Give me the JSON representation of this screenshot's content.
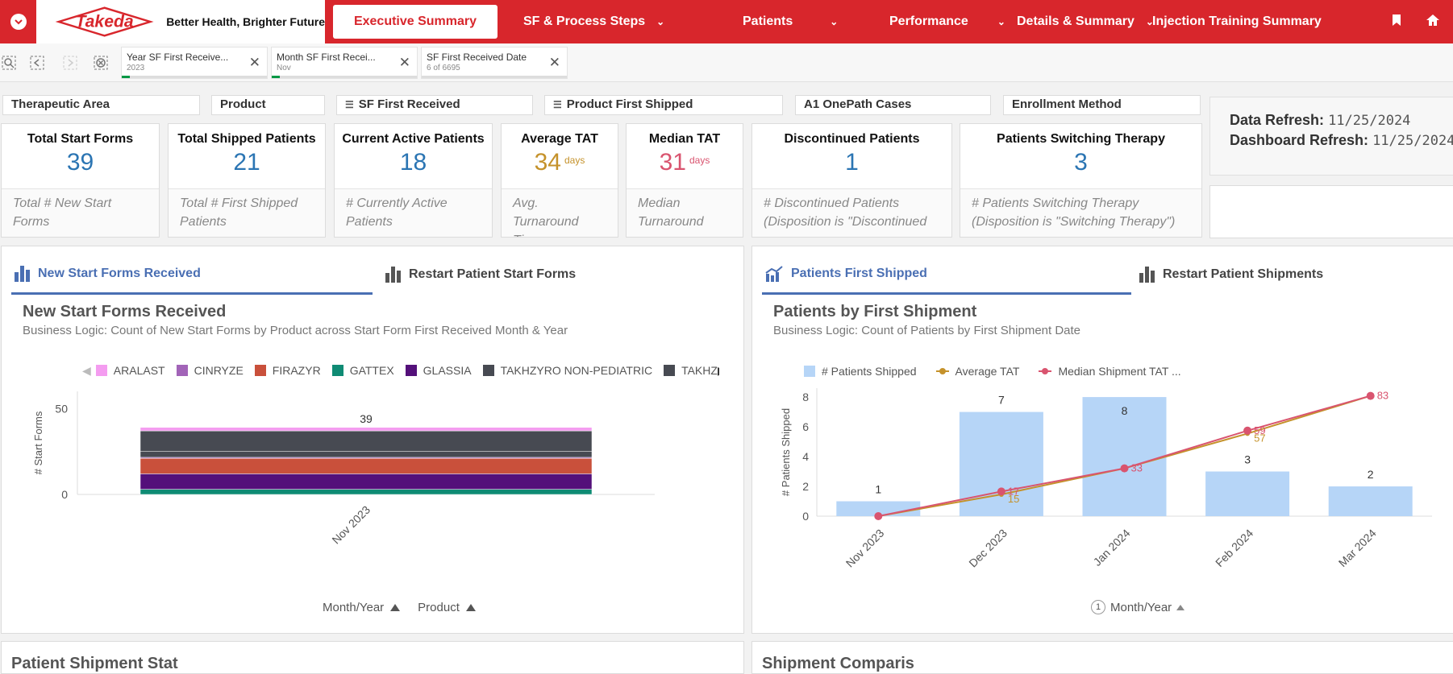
{
  "nav": {
    "brand_name": "Takeda",
    "tagline": "Better Health, Brighter Future",
    "items": [
      {
        "label": "Executive Summary"
      },
      {
        "label": "SF & Process Steps"
      },
      {
        "label": "Patients"
      },
      {
        "label": "Performance"
      },
      {
        "label": "Details & Summary"
      },
      {
        "label": "Injection Training Summary"
      }
    ]
  },
  "selections": [
    {
      "title": "Year SF First Receive...",
      "value": "2023"
    },
    {
      "title": "Month SF First Recei...",
      "value": "Nov"
    },
    {
      "title": "SF First Received Date",
      "value": "6 of 6695"
    }
  ],
  "filters": [
    "Therapeutic Area",
    "Product",
    "SF First Received",
    "Product First Shipped",
    "A1 OnePath Cases",
    "Enrollment Method"
  ],
  "kpis": [
    {
      "title": "Total Start Forms",
      "value": "39",
      "unit": "",
      "desc": "Total # New Start Forms"
    },
    {
      "title": "Total Shipped Patients",
      "value": "21",
      "unit": "",
      "desc": "Total # First Shipped Patients"
    },
    {
      "title": "Current Active Patients",
      "value": "18",
      "unit": "",
      "desc": "# Currently Active Patients"
    },
    {
      "title": "Average TAT",
      "value": "34",
      "unit": "days",
      "desc": "Avg. Turnaround Time"
    },
    {
      "title": "Median TAT",
      "value": "31",
      "unit": "days",
      "desc": "Median Turnaround"
    },
    {
      "title": "Discontinued Patients",
      "value": "1",
      "unit": "",
      "desc": "# Discontinued Patients (Disposition is \"Discontinued"
    },
    {
      "title": "Patients Switching Therapy",
      "value": "3",
      "unit": "",
      "desc": "# Patients Switching Therapy (Disposition is \"Switching Therapy\")"
    }
  ],
  "refresh": {
    "data_label": "Data Refresh:",
    "data_value": "11/25/2024",
    "dash_label": "Dashboard Refresh:",
    "dash_value": "11/25/2024"
  },
  "left_panel": {
    "tabs": [
      "New Start Forms Received",
      "Restart Patient Start Forms"
    ],
    "title": "New Start Forms Received",
    "subtitle": "Business Logic: Count of New Start Forms by Product across Start Form First Received Month & Year",
    "sort_labels": [
      "Month/Year",
      "Product"
    ]
  },
  "right_panel": {
    "tabs": [
      "Patients First Shipped",
      "Restart Patient Shipments"
    ],
    "title": "Patients by First Shipment",
    "subtitle": "Business Logic: Count of Patients by First Shipment Date",
    "sort_badge": "1",
    "sort_label": "Month/Year"
  },
  "bottom_panels": [
    "Patient Shipment Stat",
    "Shipment Comparis"
  ],
  "colors": {
    "brand_red": "#d8262c",
    "kpi_blue": "#2b75b3",
    "avg_tat": "#c5922b",
    "median_tat": "#d9546f",
    "bar_blue": "#b6d5f7",
    "tab_active": "#4a6fb3"
  },
  "chart_data": [
    {
      "type": "bar",
      "stacked": true,
      "title": "New Start Forms Received",
      "xlabel": "Month/Year",
      "ylabel": "# Start Forms",
      "ylim": [
        0,
        60
      ],
      "yticks": [
        0,
        50
      ],
      "categories": [
        "Nov 2023"
      ],
      "total_labels": [
        "39"
      ],
      "legend": "top",
      "series": [
        {
          "name": "ARALAST",
          "color": "#f49cf0",
          "values": [
            2
          ]
        },
        {
          "name": "CINRYZE",
          "color": "#a264b8",
          "values": [
            0.6
          ]
        },
        {
          "name": "FIRAZYR",
          "color": "#c9503b",
          "values": [
            9
          ]
        },
        {
          "name": "GATTEX",
          "color": "#0f8b74",
          "values": [
            3
          ]
        },
        {
          "name": "GLASSIA",
          "color": "#54107a",
          "values": [
            9
          ]
        },
        {
          "name": "TAKHZYRO NON-PEDIATRIC",
          "color": "#474a52",
          "values": [
            12
          ]
        },
        {
          "name": "TAKHZ",
          "color": "#474a52",
          "values": [
            3.4
          ]
        }
      ]
    },
    {
      "type": "bar",
      "combo": "bar+line",
      "title": "Patients by First Shipment",
      "xlabel": "Month/Year",
      "ylabel": "# Patients Shipped",
      "ylim": [
        0,
        8.6
      ],
      "yticks": [
        0,
        2,
        4,
        6,
        8
      ],
      "categories": [
        "Nov 2023",
        "Dec 2023",
        "Jan 2024",
        "Feb 2024",
        "Mar 2024"
      ],
      "legend": "top",
      "series": [
        {
          "name": "# Patients Shipped",
          "kind": "bar",
          "color": "#b6d5f7",
          "values": [
            1,
            7,
            8,
            3,
            2
          ]
        },
        {
          "name": "Average TAT",
          "kind": "line",
          "color": "#c5922b",
          "values": [
            0,
            15,
            33,
            57,
            83
          ],
          "labels": [
            "",
            "15",
            "",
            "57",
            ""
          ]
        },
        {
          "name": "Median Shipment TAT ...",
          "kind": "line",
          "color": "#d9546f",
          "values": [
            0,
            17,
            33,
            59,
            83
          ],
          "labels": [
            "",
            "17",
            "33",
            "59",
            "83"
          ]
        }
      ]
    }
  ]
}
